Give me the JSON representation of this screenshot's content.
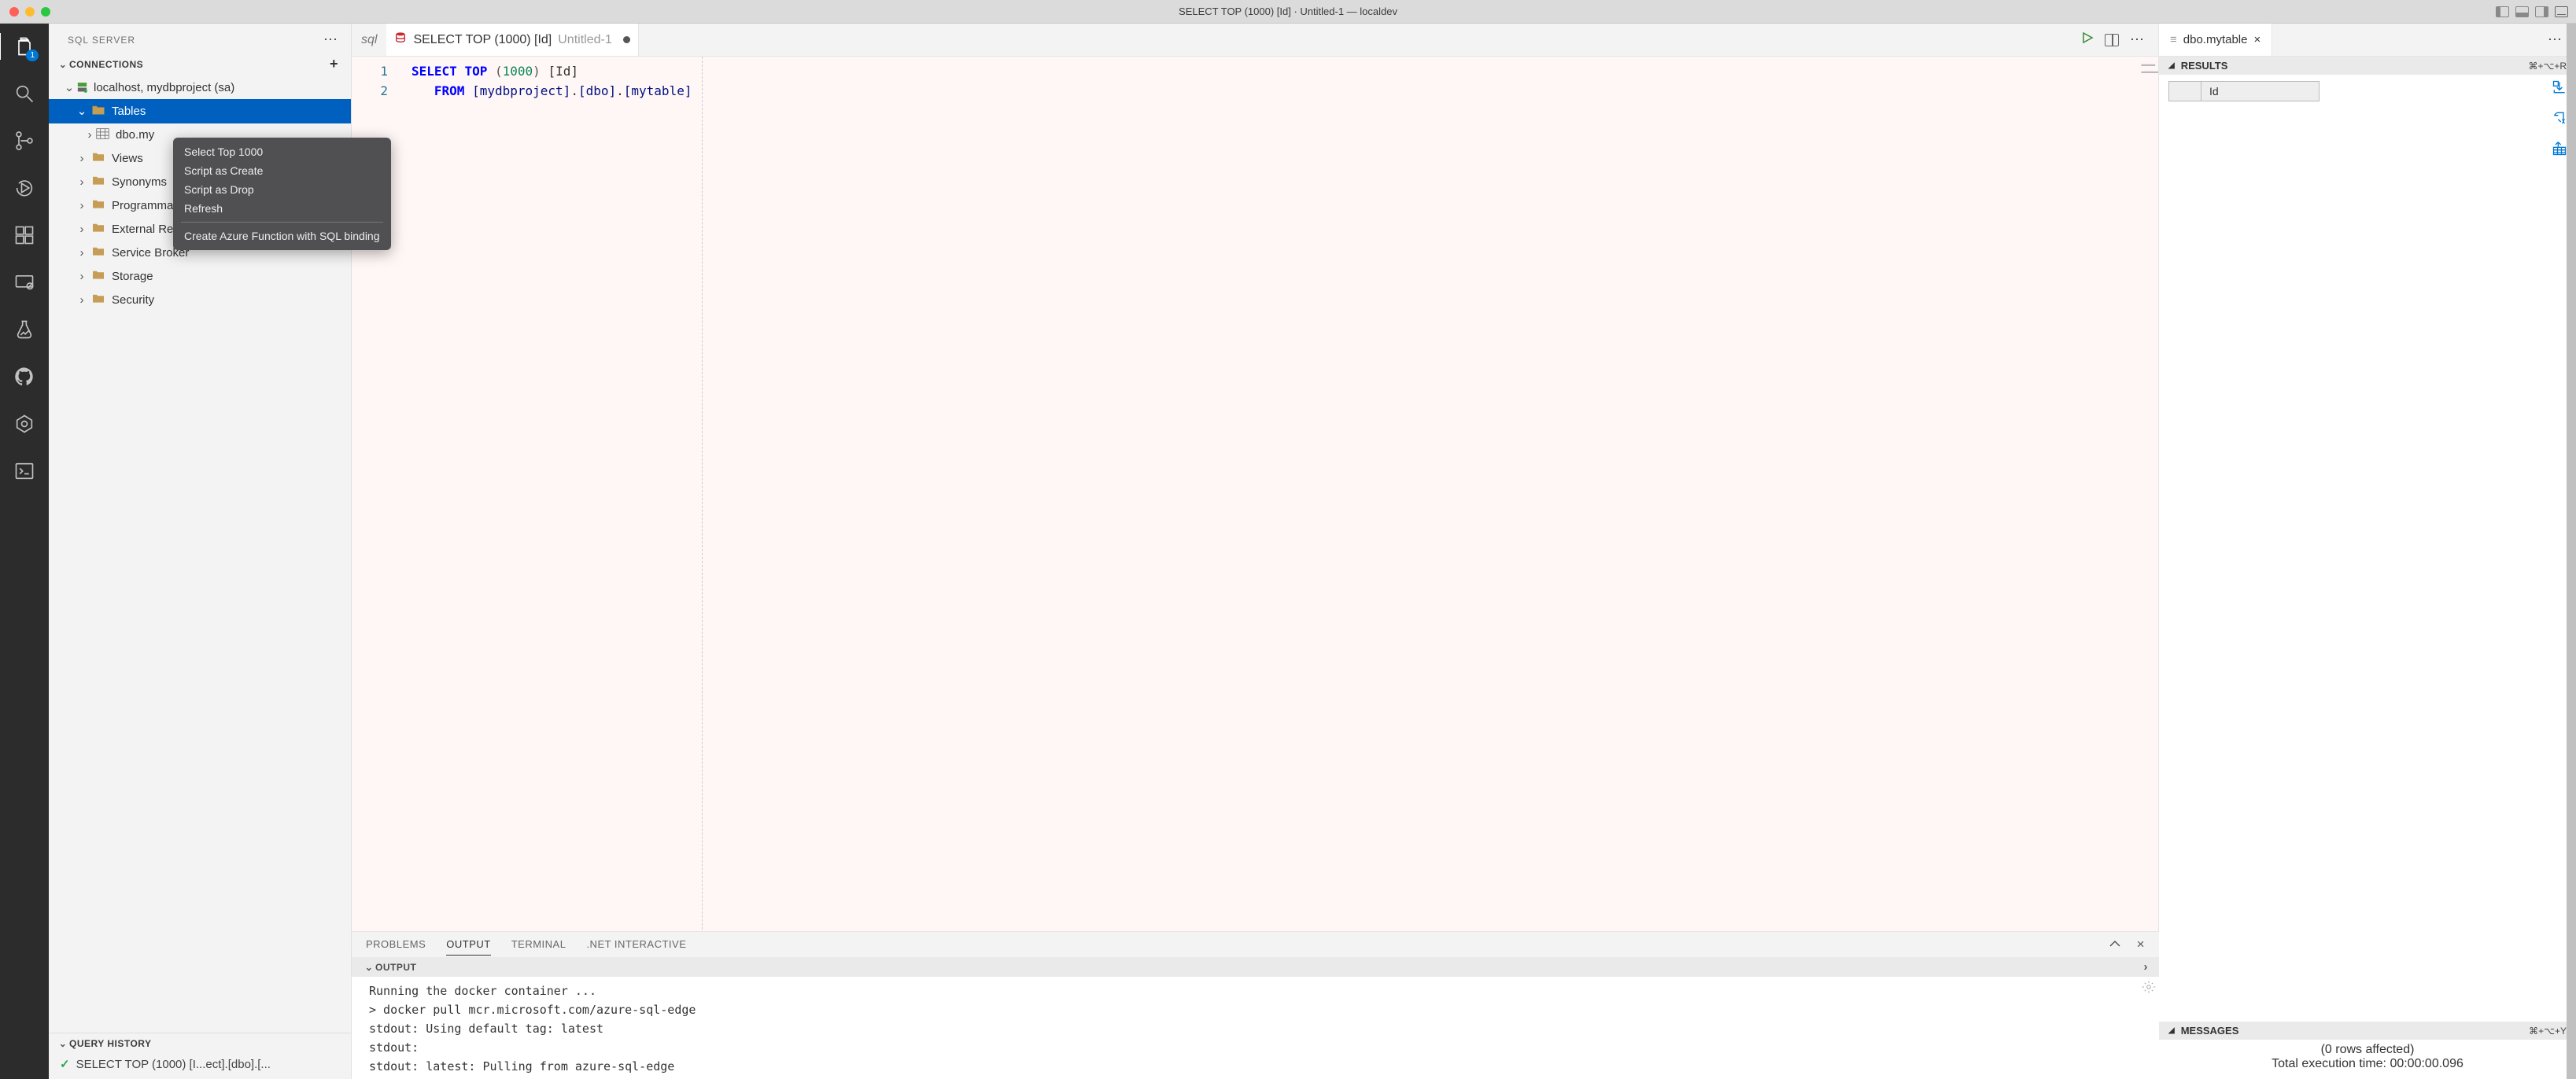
{
  "window": {
    "title": "SELECT TOP (1000) [Id] · Untitled-1 — localdev"
  },
  "activity": {
    "badge_files": "1"
  },
  "sidebar": {
    "title": "SQL SERVER",
    "sections": {
      "connections": "CONNECTIONS",
      "query_history": "QUERY HISTORY"
    },
    "connection_label": "localhost, mydbproject (sa)",
    "table_group": "Tables",
    "table_item": "dbo.my",
    "folders": [
      "Views",
      "Synonyms",
      "Programmability",
      "External Resources",
      "Service Broker",
      "Storage",
      "Security"
    ],
    "qh_item": "SELECT TOP (1000) [I...ect].[dbo].[..."
  },
  "context_menu": {
    "items_a": [
      "Select Top 1000",
      "Script as Create",
      "Script as Drop",
      "Refresh"
    ],
    "items_b": [
      "Create Azure Function with SQL binding"
    ]
  },
  "editor": {
    "tab_phantom": "sql",
    "tab_name": "SELECT TOP (1000) [Id]",
    "tab_suffix": "Untitled-1",
    "line1": {
      "a": "SELECT",
      "b": "TOP",
      "paren_l": "(",
      "num": "1000",
      "paren_r": ")",
      "col": "[Id]"
    },
    "line2": {
      "from": "FROM",
      "db": "[mydbproject]",
      "schema": "[dbo]",
      "table": "[mytable]"
    },
    "lnums": [
      "1",
      "2"
    ]
  },
  "right": {
    "tab": "dbo.mytable",
    "results_label": "RESULTS",
    "results_shortcut": "⌘+⌥+R",
    "grid_col": "Id",
    "messages_label": "MESSAGES",
    "messages_shortcut": "⌘+⌥+Y",
    "msg_rows": "(0 rows affected)",
    "msg_time": "Total execution time: 00:00:00.096"
  },
  "panel": {
    "tabs": [
      "PROBLEMS",
      "OUTPUT",
      "TERMINAL",
      ".NET INTERACTIVE"
    ],
    "active": 1,
    "output_label": "OUTPUT",
    "lines": [
      "Running the docker container ...",
      "  > docker pull mcr.microsoft.com/azure-sql-edge",
      "  stdout: Using default tag: latest",
      "  stdout:",
      "  stdout: latest: Pulling from azure-sql-edge"
    ]
  }
}
